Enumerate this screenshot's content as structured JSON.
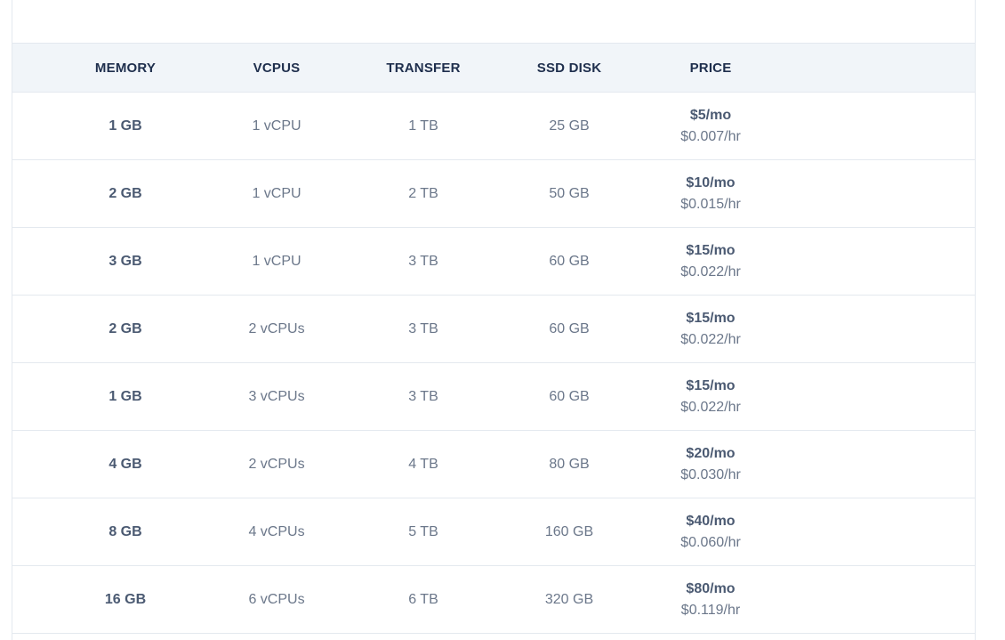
{
  "table": {
    "headers": {
      "memory": "MEMORY",
      "vcpus": "VCPUS",
      "transfer": "TRANSFER",
      "disk": "SSD DISK",
      "price": "PRICE"
    },
    "rows": [
      {
        "memory": "1 GB",
        "vcpus": "1 vCPU",
        "transfer": "1 TB",
        "disk": "25 GB",
        "price_month": "$5/mo",
        "price_hour": "$0.007/hr"
      },
      {
        "memory": "2 GB",
        "vcpus": "1 vCPU",
        "transfer": "2 TB",
        "disk": "50 GB",
        "price_month": "$10/mo",
        "price_hour": "$0.015/hr"
      },
      {
        "memory": "3 GB",
        "vcpus": "1 vCPU",
        "transfer": "3 TB",
        "disk": "60 GB",
        "price_month": "$15/mo",
        "price_hour": "$0.022/hr"
      },
      {
        "memory": "2 GB",
        "vcpus": "2 vCPUs",
        "transfer": "3 TB",
        "disk": "60 GB",
        "price_month": "$15/mo",
        "price_hour": "$0.022/hr"
      },
      {
        "memory": "1 GB",
        "vcpus": "3 vCPUs",
        "transfer": "3 TB",
        "disk": "60 GB",
        "price_month": "$15/mo",
        "price_hour": "$0.022/hr"
      },
      {
        "memory": "4 GB",
        "vcpus": "2 vCPUs",
        "transfer": "4 TB",
        "disk": "80 GB",
        "price_month": "$20/mo",
        "price_hour": "$0.030/hr"
      },
      {
        "memory": "8 GB",
        "vcpus": "4 vCPUs",
        "transfer": "5 TB",
        "disk": "160 GB",
        "price_month": "$40/mo",
        "price_hour": "$0.060/hr"
      },
      {
        "memory": "16 GB",
        "vcpus": "6 vCPUs",
        "transfer": "6 TB",
        "disk": "320 GB",
        "price_month": "$80/mo",
        "price_hour": "$0.119/hr"
      }
    ]
  },
  "colors": {
    "header_bg": "#f1f5f9",
    "header_text": "#1f2f4d",
    "body_text": "#6b778a",
    "emphasis_text": "#4b5a72",
    "border": "#e4e9ef"
  }
}
